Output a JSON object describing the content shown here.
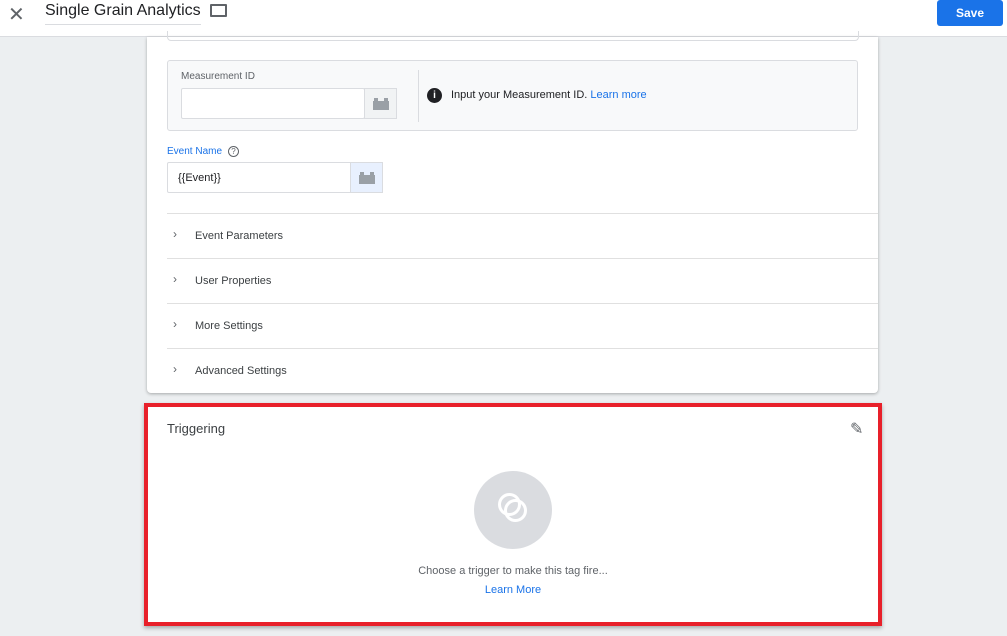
{
  "header": {
    "title": "Single Grain Analytics",
    "save_label": "Save"
  },
  "config": {
    "measurement_id": {
      "label": "Measurement ID",
      "value": "",
      "info_text": "Input your Measurement ID.",
      "info_link": "Learn more"
    },
    "event_name": {
      "label": "Event Name",
      "value": "{{Event}}"
    },
    "sections": [
      "Event Parameters",
      "User Properties",
      "More Settings",
      "Advanced Settings"
    ]
  },
  "triggering": {
    "title": "Triggering",
    "message": "Choose a trigger to make this tag fire...",
    "link": "Learn More"
  }
}
